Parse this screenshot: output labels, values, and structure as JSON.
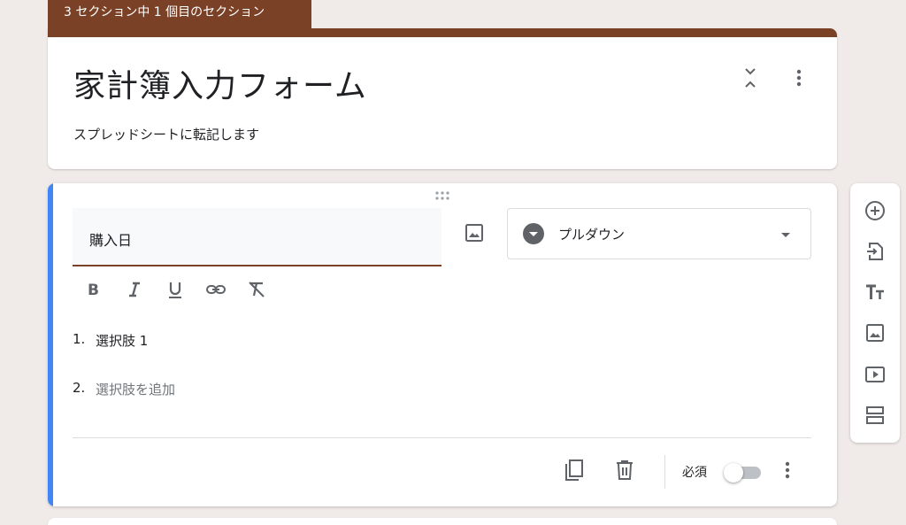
{
  "section_tab": {
    "label": "3 セクション中 1 個目のセクション"
  },
  "form": {
    "title": "家計簿入力フォーム",
    "description": "スプレッドシートに転記します",
    "accent_color": "#7b4127"
  },
  "question": {
    "title": "購入日",
    "type_label": "プルダウン",
    "options": [
      {
        "num": "1.",
        "label": "選択肢 1"
      },
      {
        "num": "2.",
        "label": "選択肢を追加"
      }
    ],
    "required_label": "必須",
    "required": false,
    "active_color": "#4285f4"
  },
  "icons": {
    "collapse": "unfold-less-icon",
    "title_more": "more-vert-icon",
    "image": "image-icon",
    "dropdown": "arrow-drop-down-circle-icon",
    "formatting": [
      "bold-icon",
      "italic-icon",
      "underline-icon",
      "link-icon",
      "clear-format-icon"
    ],
    "copy": "content-copy-icon",
    "delete": "delete-icon",
    "toolbar": [
      "add-circle-icon",
      "import-icon",
      "title-icon",
      "image-icon",
      "video-icon",
      "section-icon"
    ]
  }
}
